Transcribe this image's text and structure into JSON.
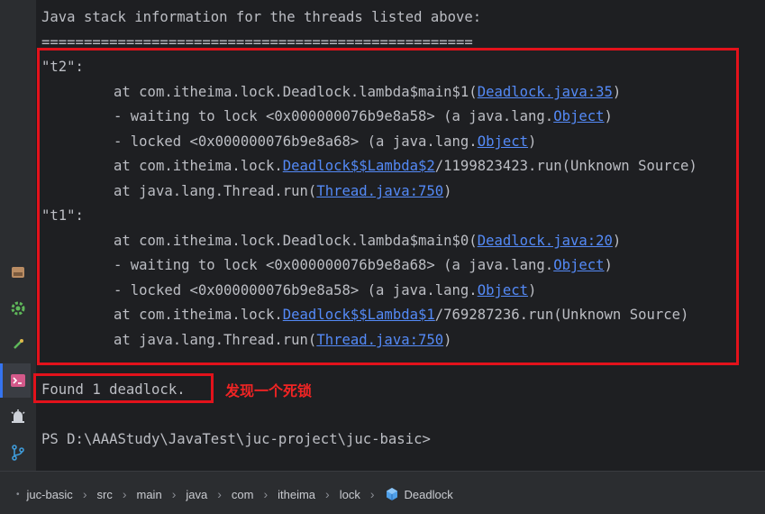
{
  "terminal": {
    "header": "Java stack information for the threads listed above:",
    "divider": "===================================================",
    "blocks": [
      {
        "thread": "\"t2\":",
        "lines": [
          {
            "pre": "at com.itheima.lock.Deadlock.lambda$main$1(",
            "link": "Deadlock.java:35",
            "post": ")"
          },
          {
            "pre": "- waiting to lock <0x000000076b9e8a58> (a java.lang.",
            "link": "Object",
            "post": ")"
          },
          {
            "pre": "- locked <0x000000076b9e8a68> (a java.lang.",
            "link": "Object",
            "post": ")"
          },
          {
            "pre": "at com.itheima.lock.",
            "link": "Deadlock$$Lambda$2",
            "post": "/1199823423.run(Unknown Source)"
          },
          {
            "pre": "at java.lang.Thread.run(",
            "link": "Thread.java:750",
            "post": ")"
          }
        ]
      },
      {
        "thread": "\"t1\":",
        "lines": [
          {
            "pre": "at com.itheima.lock.Deadlock.lambda$main$0(",
            "link": "Deadlock.java:20",
            "post": ")"
          },
          {
            "pre": "- waiting to lock <0x000000076b9e8a68> (a java.lang.",
            "link": "Object",
            "post": ")"
          },
          {
            "pre": "- locked <0x000000076b9e8a58> (a java.lang.",
            "link": "Object",
            "post": ")"
          },
          {
            "pre": "at com.itheima.lock.",
            "link": "Deadlock$$Lambda$1",
            "post": "/769287236.run(Unknown Source)"
          },
          {
            "pre": "at java.lang.Thread.run(",
            "link": "Thread.java:750",
            "post": ")"
          }
        ]
      }
    ],
    "found": "Found 1 deadlock.",
    "annotation": "发现一个死锁",
    "prompt": "PS D:\\AAAStudy\\JavaTest\\juc-project\\juc-basic>"
  },
  "sidebar": {
    "icons": [
      "database-icon",
      "gear-icon",
      "run-icon",
      "terminal-icon",
      "alert-icon",
      "git-branch-icon"
    ]
  },
  "breadcrumb": {
    "items": [
      "juc-basic",
      "src",
      "main",
      "java",
      "com",
      "itheima",
      "lock",
      "Deadlock"
    ],
    "separator": "›"
  },
  "colors": {
    "background": "#1e1f22",
    "text": "#bcbec4",
    "link": "#548af7",
    "highlight_box": "#e3121b",
    "annotation": "#f02424"
  }
}
